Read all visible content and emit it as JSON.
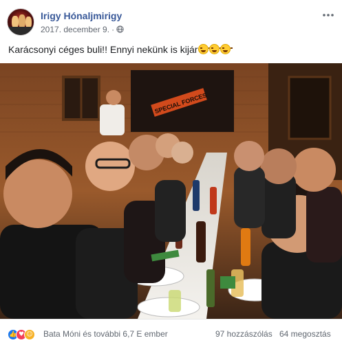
{
  "post": {
    "page_name": "Irigy Hónaljmirigy",
    "date": "2017. december 9.",
    "separator": "·",
    "text": "Karácsonyi céges buli!! Ennyi nekünk is kijár",
    "emoji_count": 3,
    "photo_sign_text": "SPECIAL FORCES"
  },
  "footer": {
    "reactions_summary": "Bata Móni és további 6,7 E ember",
    "comments": "97 hozzászólás",
    "shares": "64 megosztás",
    "reaction_icons": [
      "like-icon",
      "love-icon",
      "haha-icon"
    ]
  },
  "colors": {
    "link": "#385898",
    "meta": "#616770",
    "like": "#1877f2",
    "love": "#f33e58",
    "haha": "#f7b125"
  }
}
